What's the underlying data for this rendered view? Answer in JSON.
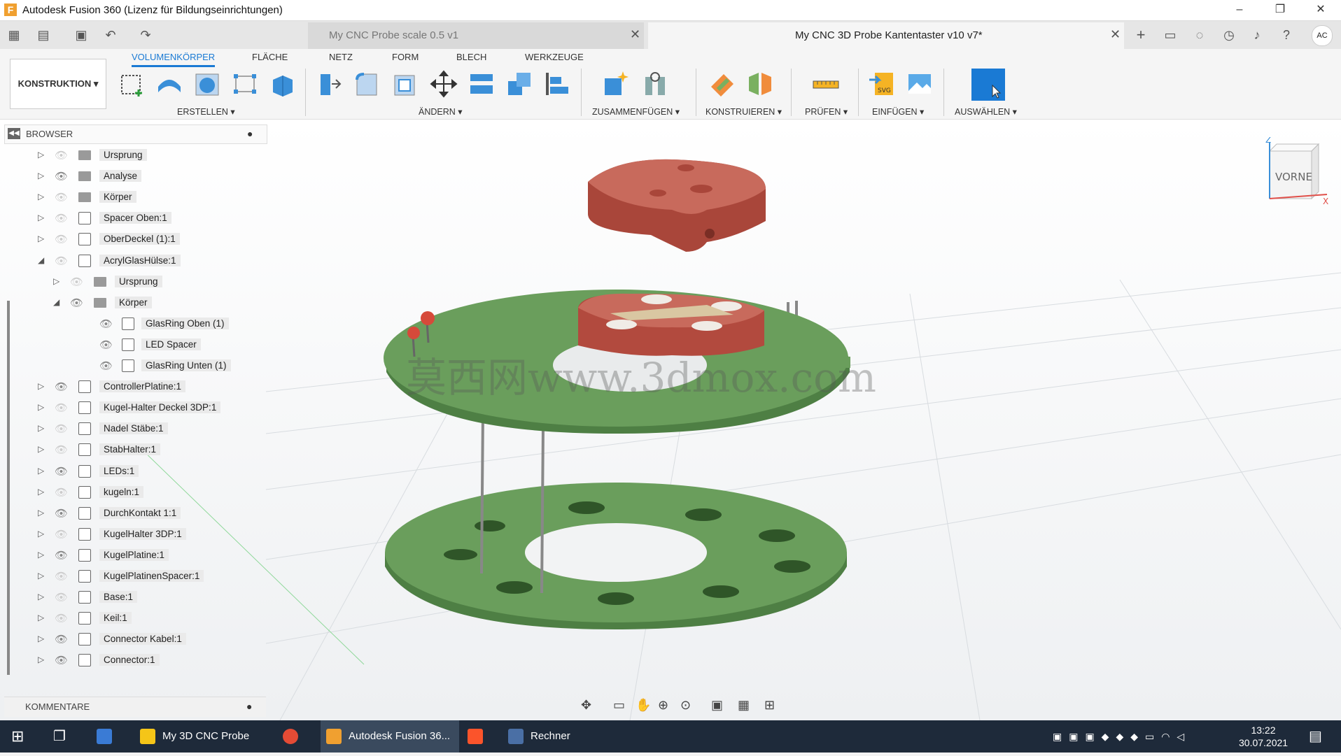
{
  "window": {
    "title": "Autodesk Fusion 360 (Lizenz für Bildungseinrichtungen)",
    "logo": "F",
    "minimize": "–",
    "maximize": "❐",
    "close": "✕"
  },
  "tabs": [
    {
      "label": "My CNC Probe scale 0.5 v1",
      "close": "✕"
    },
    {
      "label": "My CNC 3D Probe Kantentaster v10 v7*",
      "close": "✕"
    }
  ],
  "quick_access": {
    "add": "+",
    "user": "AC"
  },
  "toolbar": {
    "workspace": "KONSTRUKTION ▾",
    "ribbon_tabs": [
      "VOLUMENKÖRPER",
      "FLÄCHE",
      "NETZ",
      "FORM",
      "BLECH",
      "WERKZEUGE"
    ],
    "groups": [
      "ERSTELLEN ▾",
      "ÄNDERN ▾",
      "ZUSAMMENFÜGEN ▾",
      "KONSTRUIEREN ▾",
      "PRÜFEN ▾",
      "EINFÜGEN ▾",
      "AUSWÄHLEN ▾"
    ]
  },
  "browser": {
    "title": "BROWSER",
    "items": [
      {
        "label": "Ursprung",
        "indent": 0,
        "expanded": false,
        "visible": false,
        "type": "folder"
      },
      {
        "label": "Analyse",
        "indent": 0,
        "expanded": false,
        "visible": true,
        "type": "folder"
      },
      {
        "label": "Körper",
        "indent": 0,
        "expanded": false,
        "visible": false,
        "type": "folder"
      },
      {
        "label": "Spacer Oben:1",
        "indent": 0,
        "expanded": false,
        "visible": false,
        "type": "component"
      },
      {
        "label": "OberDeckel (1):1",
        "indent": 0,
        "expanded": false,
        "visible": false,
        "type": "component"
      },
      {
        "label": "AcrylGlasHülse:1",
        "indent": 0,
        "expanded": true,
        "visible": false,
        "type": "component"
      },
      {
        "label": "Ursprung",
        "indent": 1,
        "expanded": false,
        "visible": false,
        "type": "folder"
      },
      {
        "label": "Körper",
        "indent": 1,
        "expanded": true,
        "visible": true,
        "type": "folder"
      },
      {
        "label": "GlasRing Oben (1)",
        "indent": 2,
        "expanded": null,
        "visible": true,
        "type": "body"
      },
      {
        "label": "LED Spacer",
        "indent": 2,
        "expanded": null,
        "visible": true,
        "type": "body"
      },
      {
        "label": "GlasRing Unten (1)",
        "indent": 2,
        "expanded": null,
        "visible": true,
        "type": "body"
      },
      {
        "label": "ControllerPlatine:1",
        "indent": 0,
        "expanded": false,
        "visible": true,
        "type": "component"
      },
      {
        "label": "Kugel-Halter Deckel 3DP:1",
        "indent": 0,
        "expanded": false,
        "visible": false,
        "type": "component"
      },
      {
        "label": "Nadel Stäbe:1",
        "indent": 0,
        "expanded": false,
        "visible": false,
        "type": "component"
      },
      {
        "label": "StabHalter:1",
        "indent": 0,
        "expanded": false,
        "visible": false,
        "type": "component"
      },
      {
        "label": "LEDs:1",
        "indent": 0,
        "expanded": false,
        "visible": true,
        "type": "component"
      },
      {
        "label": "kugeln:1",
        "indent": 0,
        "expanded": false,
        "visible": false,
        "type": "component"
      },
      {
        "label": "DurchKontakt 1:1",
        "indent": 0,
        "expanded": false,
        "visible": true,
        "type": "component"
      },
      {
        "label": "KugelHalter 3DP:1",
        "indent": 0,
        "expanded": false,
        "visible": false,
        "type": "component"
      },
      {
        "label": "KugelPlatine:1",
        "indent": 0,
        "expanded": false,
        "visible": true,
        "type": "component"
      },
      {
        "label": "KugelPlatinenSpacer:1",
        "indent": 0,
        "expanded": false,
        "visible": false,
        "type": "component"
      },
      {
        "label": "Base:1",
        "indent": 0,
        "expanded": false,
        "visible": false,
        "type": "component"
      },
      {
        "label": "Keil:1",
        "indent": 0,
        "expanded": false,
        "visible": false,
        "type": "component"
      },
      {
        "label": "Connector Kabel:1",
        "indent": 0,
        "expanded": false,
        "visible": true,
        "type": "component"
      },
      {
        "label": "Connector:1",
        "indent": 0,
        "expanded": false,
        "visible": true,
        "type": "component"
      }
    ]
  },
  "comments": {
    "title": "KOMMENTARE"
  },
  "viewcube": {
    "face": "VORNE",
    "axis_z": "Z",
    "axis_x": "X"
  },
  "watermark": "莫西网www.3dmox.com",
  "taskbar": {
    "apps": [
      {
        "label": "My 3D CNC Probe",
        "color": "#f5c518"
      },
      {
        "label": "Autodesk Fusion 36...",
        "color": "#f0a030"
      },
      {
        "label": "Rechner",
        "color": "#4a6fa5"
      }
    ],
    "time": "13:22",
    "date": "30.07.2021"
  },
  "colors": {
    "accent": "#1a7ad4",
    "part_green": "#6a9e5c",
    "part_red": "#c0574a"
  }
}
